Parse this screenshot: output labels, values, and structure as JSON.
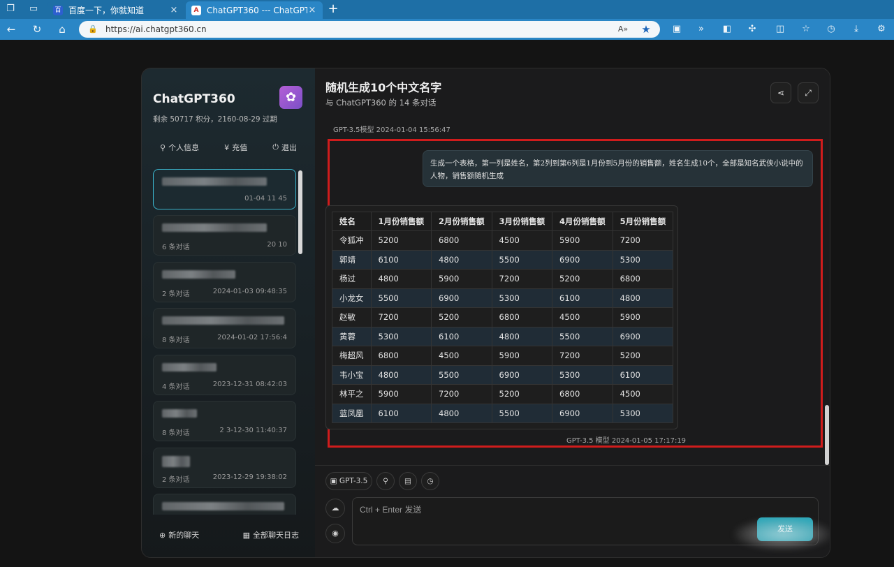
{
  "browser": {
    "tabs": [
      {
        "title": "百度一下，你就知道",
        "active": false
      },
      {
        "title": "ChatGPT360 --- ChatGPT360",
        "active": true
      }
    ],
    "new_tab": "+",
    "close": "×",
    "url": "https://ai.chatgpt360.cn",
    "read_aloud": "A»"
  },
  "sidebar": {
    "brand": "ChatGPT360",
    "credits": "剩余 50717 积分，2160-08-29 过期",
    "actions": [
      {
        "label": "个人信息",
        "icon": "user-icon"
      },
      {
        "label": "充值",
        "icon": "yen-icon"
      },
      {
        "label": "退出",
        "icon": "power-icon"
      }
    ],
    "conversations": [
      {
        "count": "",
        "time": "01-04 11  45",
        "active": true
      },
      {
        "count": "6 条对话",
        "time": "20       10",
        "active": false
      },
      {
        "count": "2 条对话",
        "time": "2024-01-03 09:48:35",
        "active": false
      },
      {
        "count": "8 条对话",
        "time": "2024-01-02 17:56:4",
        "active": false
      },
      {
        "count": "4 条对话",
        "time": "2023-12-31 08:42:03",
        "active": false
      },
      {
        "count": "8 条对话",
        "time": "2 3-12-30 11:40:37",
        "active": false
      },
      {
        "count": "2 条对话",
        "time": "2023-12-29 19:38:02",
        "active": false
      },
      {
        "count": "",
        "time": "",
        "active": false
      }
    ],
    "footer": {
      "new_chat": "新的聊天",
      "all_logs": "全部聊天日志"
    }
  },
  "chat": {
    "title": "随机生成10个中文名字",
    "subtitle": "与 ChatGPT360 的 14 条对话",
    "prev_meta": "GPT-3.5模型   2024-01-04 15:56:47",
    "user_message": "生成一个表格，第一列是姓名，第2列到第6列是1月份到5月份的销售额，姓名生成10个，全部是知名武侠小说中的人物，销售额随机生成",
    "table": {
      "headers": [
        "姓名",
        "1月份销售额",
        "2月份销售额",
        "3月份销售额",
        "4月份销售额",
        "5月份销售额"
      ],
      "rows": [
        [
          "令狐冲",
          "5200",
          "6800",
          "4500",
          "5900",
          "7200"
        ],
        [
          "郭靖",
          "6100",
          "4800",
          "5500",
          "6900",
          "5300"
        ],
        [
          "杨过",
          "4800",
          "5900",
          "7200",
          "5200",
          "6800"
        ],
        [
          "小龙女",
          "5500",
          "6900",
          "5300",
          "6100",
          "4800"
        ],
        [
          "赵敏",
          "7200",
          "5200",
          "6800",
          "4500",
          "5900"
        ],
        [
          "黄蓉",
          "5300",
          "6100",
          "4800",
          "5500",
          "6900"
        ],
        [
          "梅超风",
          "6800",
          "4500",
          "5900",
          "7200",
          "5200"
        ],
        [
          "韦小宝",
          "4800",
          "5500",
          "6900",
          "5300",
          "6100"
        ],
        [
          "林平之",
          "5900",
          "7200",
          "5200",
          "6800",
          "4500"
        ],
        [
          "蓝凤凰",
          "6100",
          "4800",
          "5500",
          "6900",
          "5300"
        ]
      ]
    },
    "answer_meta": "GPT-3.5 模型   2024-01-05 17:17:19"
  },
  "composer": {
    "model_label": "GPT-3.5",
    "placeholder": "Ctrl + Enter 发送",
    "send_label": "发送"
  },
  "colors": {
    "accent": "#3bb4cc",
    "highlight": "#d01c1c",
    "tab_bar": "#1e6fa6"
  }
}
